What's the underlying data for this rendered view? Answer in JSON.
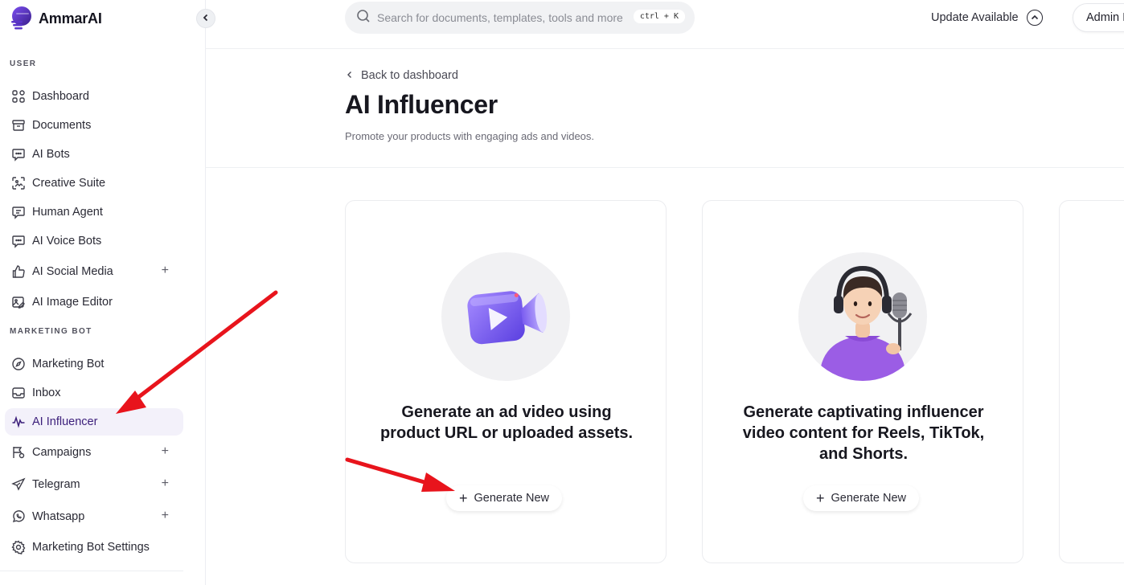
{
  "app": {
    "name": "AmmarAI"
  },
  "sidebar": {
    "sections": [
      {
        "label": "USER"
      },
      {
        "label": "MARKETING BOT"
      }
    ],
    "items": [
      {
        "label": "Dashboard",
        "icon": "grid-icon"
      },
      {
        "label": "Documents",
        "icon": "archive-icon"
      },
      {
        "label": "AI Bots",
        "icon": "chat-bot-icon"
      },
      {
        "label": "Creative Suite",
        "icon": "image-frame-icon"
      },
      {
        "label": "Human Agent",
        "icon": "chat-icon"
      },
      {
        "label": "AI Voice Bots",
        "icon": "chat-bot-icon"
      },
      {
        "label": "AI Social Media",
        "icon": "thumbs-up-icon",
        "expand": "+"
      },
      {
        "label": "AI Image Editor",
        "icon": "image-edit-icon"
      },
      {
        "label": "Marketing Bot",
        "icon": "compass-icon"
      },
      {
        "label": "Inbox",
        "icon": "inbox-icon"
      },
      {
        "label": "AI Influencer",
        "icon": "wave-icon",
        "active": true
      },
      {
        "label": "Campaigns",
        "icon": "campaign-icon",
        "expand": "+"
      },
      {
        "label": "Telegram",
        "icon": "send-icon",
        "expand": "+"
      },
      {
        "label": "Whatsapp",
        "icon": "whatsapp-icon",
        "expand": "+"
      },
      {
        "label": "Marketing Bot Settings",
        "icon": "gear-icon"
      }
    ]
  },
  "topbar": {
    "search_placeholder": "Search for documents, templates, tools and more",
    "shortcut": "ctrl + K",
    "update_label": "Update Available",
    "user_label": "Admin I"
  },
  "page": {
    "back_label": "Back to dashboard",
    "title": "AI Influencer",
    "subtitle": "Promote your products with engaging ads and videos."
  },
  "cards": [
    {
      "title": "Generate an ad video using product URL or uploaded assets.",
      "button": "Generate New",
      "illustration": "video-camera-icon"
    },
    {
      "title": "Generate captivating influencer video content for Reels, TikTok, and Shorts.",
      "button": "Generate New",
      "illustration": "podcaster-icon"
    }
  ],
  "colors": {
    "accent": "#3b1e7a",
    "active_bg": "#f3f1fa",
    "arrow": "#e8141c",
    "brand_purple": "#6b3fd9"
  }
}
